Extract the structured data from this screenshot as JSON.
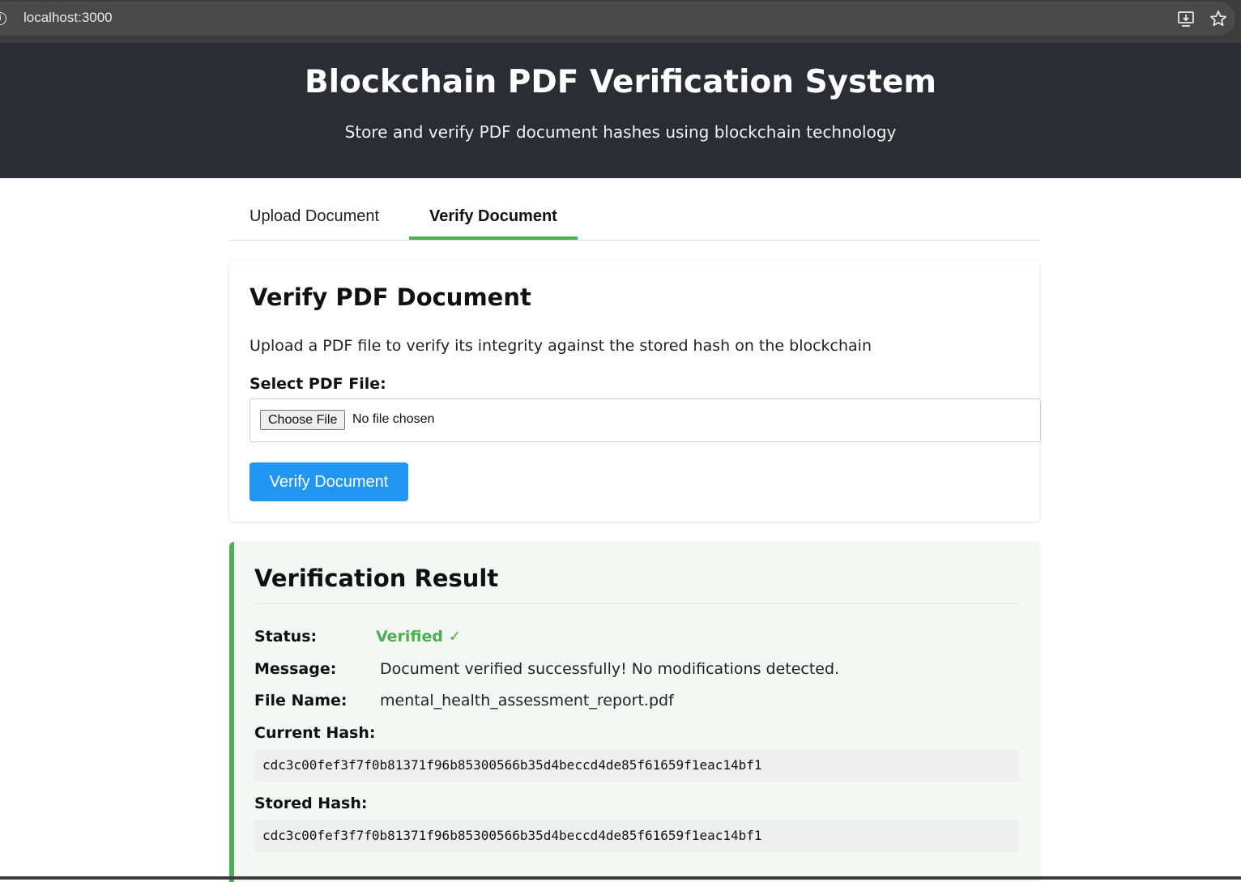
{
  "browser": {
    "url": "localhost:3000"
  },
  "header": {
    "title": "Blockchain PDF Verification System",
    "subtitle": "Store and verify PDF document hashes using blockchain technology"
  },
  "tabs": [
    {
      "label": "Upload Document",
      "active": false
    },
    {
      "label": "Verify Document",
      "active": true
    }
  ],
  "verify_card": {
    "title": "Verify PDF Document",
    "description": "Upload a PDF file to verify its integrity against the stored hash on the blockchain",
    "file_label": "Select PDF File:",
    "choose_button": "Choose File",
    "file_status": "No file chosen",
    "submit_button": "Verify Document"
  },
  "result": {
    "title": "Verification Result",
    "status_label": "Status:",
    "status_value": "Verified ✓",
    "message_label": "Message:",
    "message_value": "Document verified successfully! No modifications detected.",
    "file_name_label": "File Name:",
    "file_name_value": "mental_health_assessment_report.pdf",
    "current_hash_label": "Current Hash:",
    "current_hash_value": "cdc3c00fef3f7f0b81371f96b85300566b35d4beccd4de85f61659f1eac14bf1",
    "stored_hash_label": "Stored Hash:",
    "stored_hash_value": "cdc3c00fef3f7f0b81371f96b85300566b35d4beccd4de85f61659f1eac14bf1"
  },
  "colors": {
    "header_bg": "#2a2d33",
    "accent_green": "#4caf50",
    "button_blue": "#2196f3",
    "result_bg": "#f4f8f4"
  },
  "icons": [
    "info-icon",
    "install-app-icon",
    "bookmark-star-icon"
  ]
}
